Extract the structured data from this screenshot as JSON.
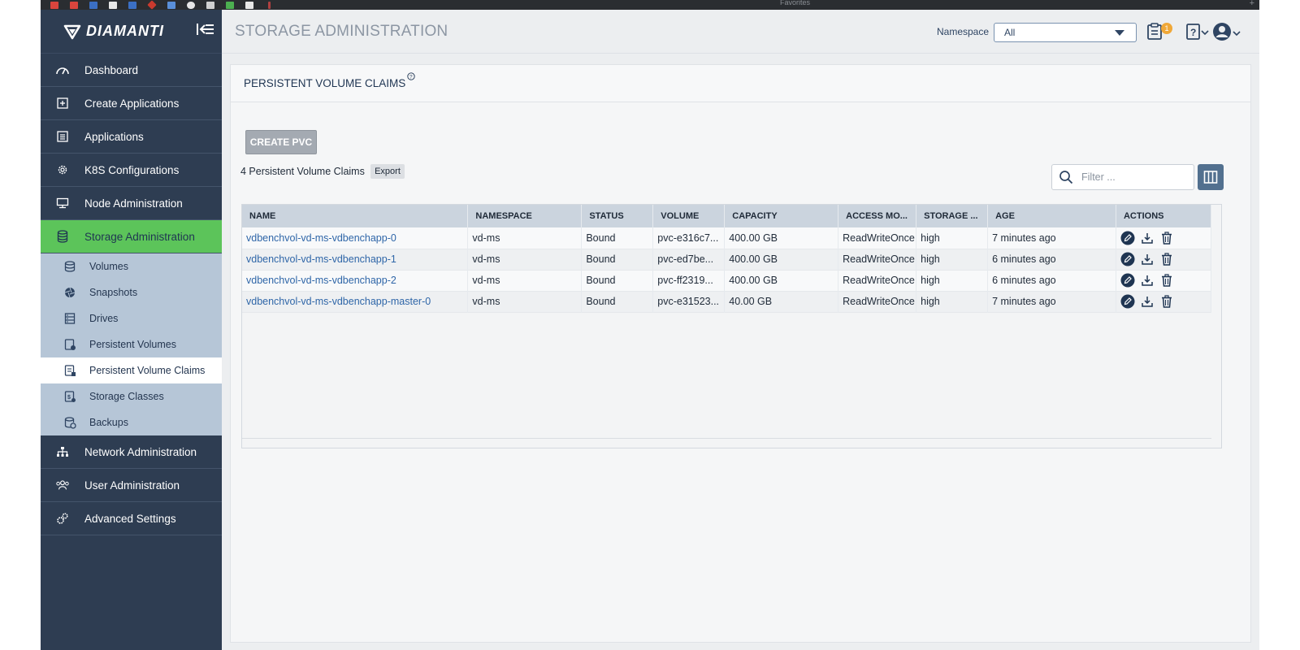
{
  "browser": {
    "favorites_label": "Favorites"
  },
  "sidebar": {
    "logo_text": "DIAMANTI",
    "items": [
      {
        "label": "Dashboard",
        "icon": "gauge-icon"
      },
      {
        "label": "Create Applications",
        "icon": "plus-square-icon"
      },
      {
        "label": "Applications",
        "icon": "list-icon"
      },
      {
        "label": "K8S Configurations",
        "icon": "gear-cog-icon"
      },
      {
        "label": "Node Administration",
        "icon": "monitor-icon"
      },
      {
        "label": "Storage Administration",
        "icon": "database-icon",
        "active": true
      }
    ],
    "storage_subitems": [
      {
        "label": "Volumes",
        "icon": "volume-disk-icon"
      },
      {
        "label": "Snapshots",
        "icon": "aperture-icon"
      },
      {
        "label": "Drives",
        "icon": "drives-icon"
      },
      {
        "label": "Persistent Volumes",
        "icon": "persistent-volume-icon"
      },
      {
        "label": "Persistent Volume Claims",
        "icon": "pvc-icon",
        "active": true
      },
      {
        "label": "Storage Classes",
        "icon": "storage-class-icon"
      },
      {
        "label": "Backups",
        "icon": "backup-icon"
      }
    ],
    "bottom_items": [
      {
        "label": "Network Administration",
        "icon": "network-tree-icon"
      },
      {
        "label": "User Administration",
        "icon": "users-icon"
      },
      {
        "label": "Advanced Settings",
        "icon": "cogs-icon"
      }
    ]
  },
  "header": {
    "title": "STORAGE ADMINISTRATION",
    "namespace_label": "Namespace",
    "namespace_value": "All",
    "notification_count": "1"
  },
  "panel": {
    "title": "PERSISTENT VOLUME CLAIMS",
    "help_mark": "?",
    "create_button": "CREATE PVC",
    "count_label": "4 Persistent Volume Claims",
    "export_button": "Export",
    "filter_placeholder": "Filter ..."
  },
  "table": {
    "columns": [
      "NAME",
      "NAMESPACE",
      "STATUS",
      "VOLUME",
      "CAPACITY",
      "ACCESS MO...",
      "STORAGE ...",
      "AGE",
      "ACTIONS"
    ],
    "rows": [
      {
        "name": "vdbenchvol-vd-ms-vdbenchapp-0",
        "namespace": "vd-ms",
        "status": "Bound",
        "volume": "pvc-e316c7...",
        "capacity": "400.00 GB",
        "access": "ReadWriteOnce",
        "storage": "high",
        "age": "7 minutes ago"
      },
      {
        "name": "vdbenchvol-vd-ms-vdbenchapp-1",
        "namespace": "vd-ms",
        "status": "Bound",
        "volume": "pvc-ed7be...",
        "capacity": "400.00 GB",
        "access": "ReadWriteOnce",
        "storage": "high",
        "age": "6 minutes ago"
      },
      {
        "name": "vdbenchvol-vd-ms-vdbenchapp-2",
        "namespace": "vd-ms",
        "status": "Bound",
        "volume": "pvc-ff2319...",
        "capacity": "400.00 GB",
        "access": "ReadWriteOnce",
        "storage": "high",
        "age": "6 minutes ago"
      },
      {
        "name": "vdbenchvol-vd-ms-vdbenchapp-master-0",
        "namespace": "vd-ms",
        "status": "Bound",
        "volume": "pvc-e31523...",
        "capacity": "40.00 GB",
        "access": "ReadWriteOnce",
        "storage": "high",
        "age": "7 minutes ago"
      }
    ]
  },
  "colors": {
    "sidebar_bg": "#2e3d52",
    "active_green": "#5cc45a",
    "submenu_bg": "#b6c6d7",
    "link_blue": "#2f66a8",
    "badge_orange": "#f0a838"
  }
}
